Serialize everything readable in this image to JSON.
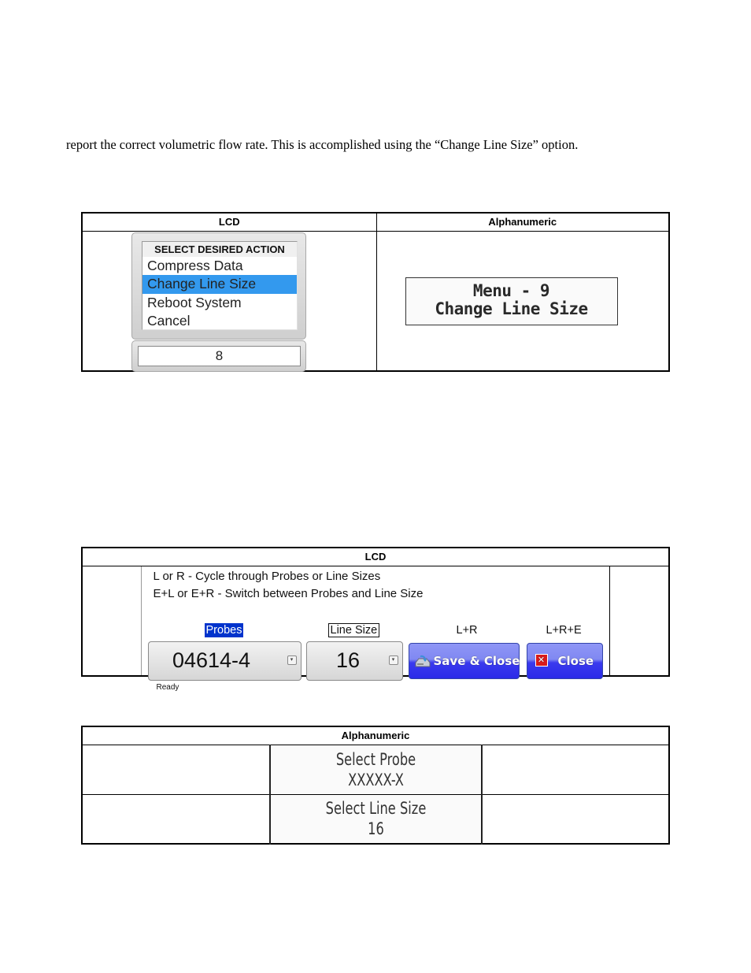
{
  "paragraph": "report the correct volumetric flow rate. This is accomplished using the “Change Line Size” option.",
  "table1": {
    "headers": [
      "LCD",
      "Alphanumeric"
    ],
    "lcd_menu": {
      "title": "SELECT DESIRED ACTION",
      "items": [
        {
          "label": "Compress Data",
          "selected": false
        },
        {
          "label": "Change Line Size",
          "selected": true
        },
        {
          "label": "Reboot System",
          "selected": false
        },
        {
          "label": "Cancel",
          "selected": false
        }
      ],
      "number_field": "8",
      "highlight_color": "#3399ee"
    },
    "alphanumeric": {
      "line1": "Menu - 9",
      "line2": "Change Line Size"
    }
  },
  "table2": {
    "header": "LCD",
    "instructions": [
      "L or R - Cycle through Probes or Line Sizes",
      "E+L or E+R - Switch between Probes and Line Size"
    ],
    "labels": {
      "probes": "Probes",
      "line_size": "Line Size",
      "save_shortcut": "L+R",
      "close_shortcut": "L+R+E"
    },
    "probe_combo": {
      "value": "04614-4",
      "icon": "dropdown-arrow-icon"
    },
    "line_size_combo": {
      "value": "16",
      "icon": "dropdown-arrow-icon"
    },
    "save_button": {
      "label": "Save & Close",
      "icon": "save-drive-icon"
    },
    "close_button": {
      "label": "Close",
      "icon": "red-x-icon"
    },
    "status": "Ready",
    "accent_color": "#0033cc"
  },
  "table3": {
    "header": "Alphanumeric",
    "rows": [
      {
        "line1": "Select Probe",
        "line2": "XXXXX-X"
      },
      {
        "line1": "Select Line Size",
        "line2": "16"
      }
    ]
  }
}
